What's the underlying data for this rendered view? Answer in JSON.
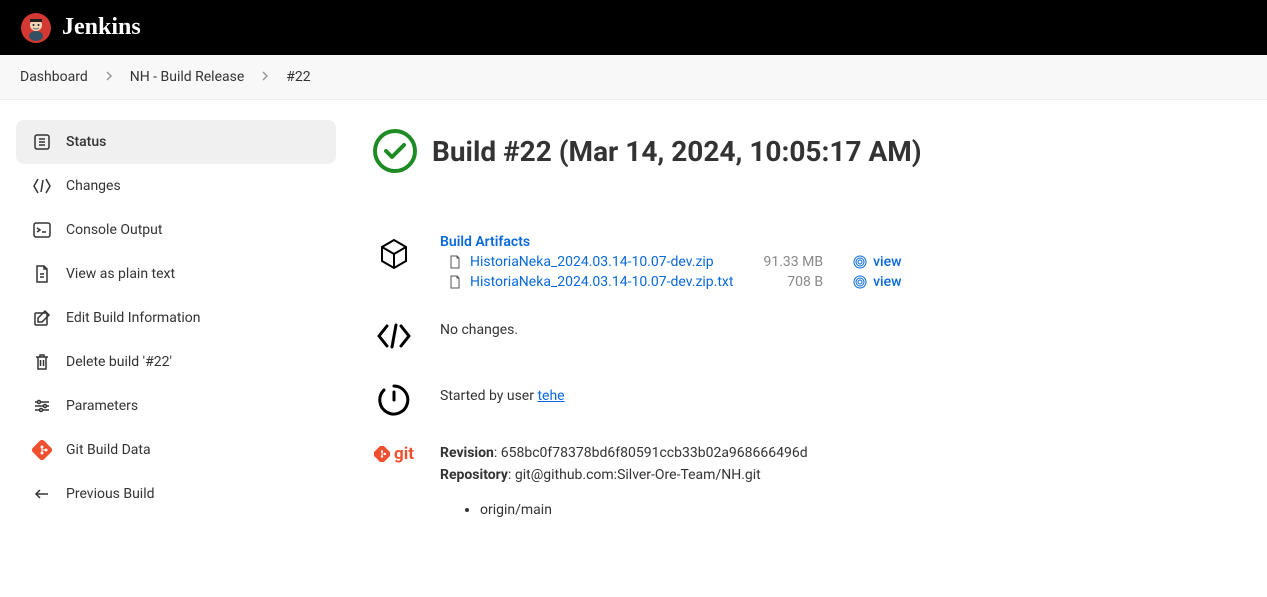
{
  "header": {
    "title": "Jenkins"
  },
  "breadcrumb": {
    "items": [
      "Dashboard",
      "NH - Build Release",
      "#22"
    ]
  },
  "sidebar": {
    "items": [
      {
        "label": "Status"
      },
      {
        "label": "Changes"
      },
      {
        "label": "Console Output"
      },
      {
        "label": "View as plain text"
      },
      {
        "label": "Edit Build Information"
      },
      {
        "label": "Delete build '#22'"
      },
      {
        "label": "Parameters"
      },
      {
        "label": "Git Build Data"
      },
      {
        "label": "Previous Build"
      }
    ]
  },
  "page": {
    "title": "Build #22 (Mar 14, 2024, 10:05:17 AM)"
  },
  "artifacts": {
    "title": "Build Artifacts",
    "view_label": "view",
    "files": [
      {
        "name": "HistoriaNeka_2024.03.14-10.07-dev.zip",
        "size": "91.33 MB"
      },
      {
        "name": "HistoriaNeka_2024.03.14-10.07-dev.zip.txt",
        "size": "708 B"
      }
    ]
  },
  "changes": {
    "text": "No changes."
  },
  "trigger": {
    "prefix": "Started by user ",
    "user": "tehe"
  },
  "git": {
    "revision_label": "Revision",
    "revision": "658bc0f78378bd6f80591ccb33b02a968666496d",
    "repository_label": "Repository",
    "repository": "git@github.com:Silver-Ore-Team/NH.git",
    "branches": [
      "origin/main"
    ],
    "label": "git"
  }
}
